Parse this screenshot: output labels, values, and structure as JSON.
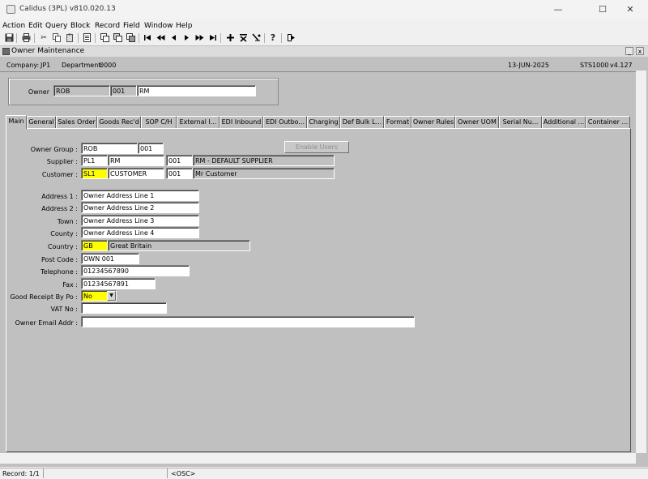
{
  "window": {
    "title": "Calidus (3PL) v810.020.13",
    "controls": {
      "minimize": "—",
      "maximize": "☐",
      "close": "✕"
    }
  },
  "menu": [
    "Action",
    "Edit",
    "Query",
    "Block",
    "Record",
    "Field",
    "Window",
    "Help"
  ],
  "toolbar_icons": [
    "save-icon",
    "print-icon",
    "cut-icon",
    "copy-icon",
    "paste-icon",
    "clear-icon",
    "new-window-icon",
    "copy-record-icon",
    "duplicate-icon",
    "first-record-icon",
    "prev-set-icon",
    "prev-record-icon",
    "next-record-icon",
    "next-set-icon",
    "last-record-icon",
    "insert-record-icon",
    "delete-record-icon",
    "query-icon",
    "help-icon",
    "exit-icon"
  ],
  "form": {
    "title": "Owner Maintenance",
    "company_label": "Company:",
    "company_value": "JP1",
    "department_label": "Department:",
    "department_value": "0000",
    "date": "13-JUN-2025",
    "screen": "STS1000",
    "version": "v4.127",
    "min_btn": "_",
    "close_btn": "x"
  },
  "owner": {
    "label": "Owner",
    "code": "ROB",
    "num": "001",
    "name": "RM"
  },
  "tabs": [
    "Main",
    "General",
    "Sales Order",
    "Goods Rec'd",
    "SOP C/H",
    "External I...",
    "EDI Inbound",
    "EDI Outbo...",
    "Charging",
    "Def Bulk L...",
    "Format",
    "Owner Rules",
    "Owner UOM",
    "Serial Nu...",
    "Additional ...",
    "Container ..."
  ],
  "main": {
    "owner_group": {
      "label": "Owner Group :",
      "code": "ROB",
      "num": "001"
    },
    "enable_users": "Enable Users",
    "supplier": {
      "label": "Supplier :",
      "code": "PL1",
      "name": "RM",
      "num": "001",
      "desc": "RM - DEFAULT SUPPLIER"
    },
    "customer": {
      "label": "Customer :",
      "code": "SL1",
      "name": "CUSTOMER",
      "num": "001",
      "desc": "Mr Customer"
    },
    "address1": {
      "label": "Address 1 :",
      "value": "Owner Address Line 1"
    },
    "address2": {
      "label": "Address 2 :",
      "value": "Owner Address Line 2"
    },
    "town": {
      "label": "Town :",
      "value": "Owner Address Line 3"
    },
    "county": {
      "label": "County :",
      "value": "Owner Address Line 4"
    },
    "country": {
      "label": "Country :",
      "code": "GB",
      "name": "Great Britain"
    },
    "post_code": {
      "label": "Post Code :",
      "value": "OWN 001"
    },
    "telephone": {
      "label": "Telephone :",
      "value": "01234567890"
    },
    "fax": {
      "label": "Fax :",
      "value": "01234567891"
    },
    "good_receipt": {
      "label": "Good Receipt By Po :",
      "value": "No"
    },
    "vat_no": {
      "label": "VAT No :",
      "value": ""
    },
    "email": {
      "label": "Owner Email Addr :",
      "value": ""
    }
  },
  "status": {
    "record": "Record: 1/1",
    "mode": "<OSC>"
  }
}
